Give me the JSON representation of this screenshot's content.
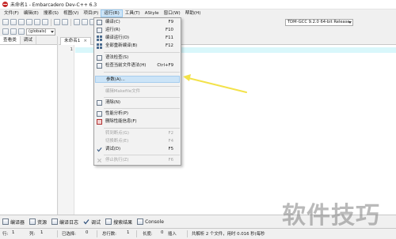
{
  "window": {
    "title": "未命名1 - Embarcadero Dev-C++ 6.3"
  },
  "menubar": [
    "文件(F)",
    "编辑(E)",
    "搜索(S)",
    "视图(V)",
    "项目(P)",
    "运行(R)",
    "工具(T)",
    "AStyle",
    "窗口(W)",
    "帮助(H)"
  ],
  "toolbar": {
    "scope_combo": "(globals)",
    "compiler_combo": "TDM-GCC 9.2.0 64-bit Release"
  },
  "left_panel": {
    "tabs": [
      "查看类",
      "调试"
    ]
  },
  "editor": {
    "tab_label": "未命名1",
    "tab_close": "×",
    "line_number": "1"
  },
  "run_menu": {
    "items": [
      {
        "label": "编译(C)",
        "shortcut": "F9",
        "icon": "compile-icon",
        "disabled": false
      },
      {
        "label": "运行(R)",
        "shortcut": "F10",
        "icon": "run-icon",
        "disabled": false
      },
      {
        "label": "编译运行(O)",
        "shortcut": "F11",
        "icon": "compile-run-icon",
        "disabled": false
      },
      {
        "label": "全部重新编译(B)",
        "shortcut": "F12",
        "icon": "rebuild-icon",
        "disabled": false
      },
      {
        "label": "语法检查(S)",
        "shortcut": "",
        "icon": "syntax-check-icon",
        "disabled": false
      },
      {
        "label": "检查当前文件语法(H)",
        "shortcut": "Ctrl+F9",
        "icon": "syntax-check-file-icon",
        "disabled": false
      },
      {
        "label": "参数(A)...",
        "shortcut": "",
        "icon": "",
        "disabled": false,
        "highlight": true
      },
      {
        "label": "编辑Makefile文件",
        "shortcut": "",
        "icon": "",
        "disabled": true
      },
      {
        "label": "清除(N)",
        "shortcut": "",
        "icon": "clean-icon",
        "disabled": false
      },
      {
        "label": "性能分析(P)",
        "shortcut": "",
        "icon": "profile-icon",
        "disabled": false
      },
      {
        "label": "删除性能信息(F)",
        "shortcut": "",
        "icon": "delete-profile-icon",
        "disabled": false
      },
      {
        "label": "转到断点(G)",
        "shortcut": "F2",
        "icon": "",
        "disabled": true
      },
      {
        "label": "切换断点(E)",
        "shortcut": "F4",
        "icon": "",
        "disabled": true
      },
      {
        "label": "调试(D)",
        "shortcut": "F5",
        "icon": "debug-icon",
        "disabled": false
      },
      {
        "label": "停止执行(Z)",
        "shortcut": "F6",
        "icon": "stop-icon",
        "disabled": true
      }
    ]
  },
  "bottom_tabs": [
    {
      "label": "编译器",
      "icon": "compiler-icon"
    },
    {
      "label": "资源",
      "icon": "resources-icon"
    },
    {
      "label": "编译日志",
      "icon": "compile-log-icon"
    },
    {
      "label": "调试",
      "icon": "debug-icon"
    },
    {
      "label": "搜索结果",
      "icon": "search-results-icon"
    },
    {
      "label": "Console",
      "icon": "console-icon"
    }
  ],
  "statusbar": {
    "row_label": "行:",
    "row_value": "1",
    "col_label": "列:",
    "col_value": "1",
    "selected_label": "已选择:",
    "selected_value": "0",
    "total_label": "总行数:",
    "total_value": "1",
    "length_label": "长度:",
    "length_value": "0",
    "mode": "插入",
    "parse_info": "共解析 2 个文件，用时 0.016 秒(每秒"
  },
  "watermark": "软件技巧",
  "colors": {
    "highlight": "#cce4f7",
    "annotation_arrow": "#f3e24b",
    "current_line": "#d9f7fb"
  }
}
